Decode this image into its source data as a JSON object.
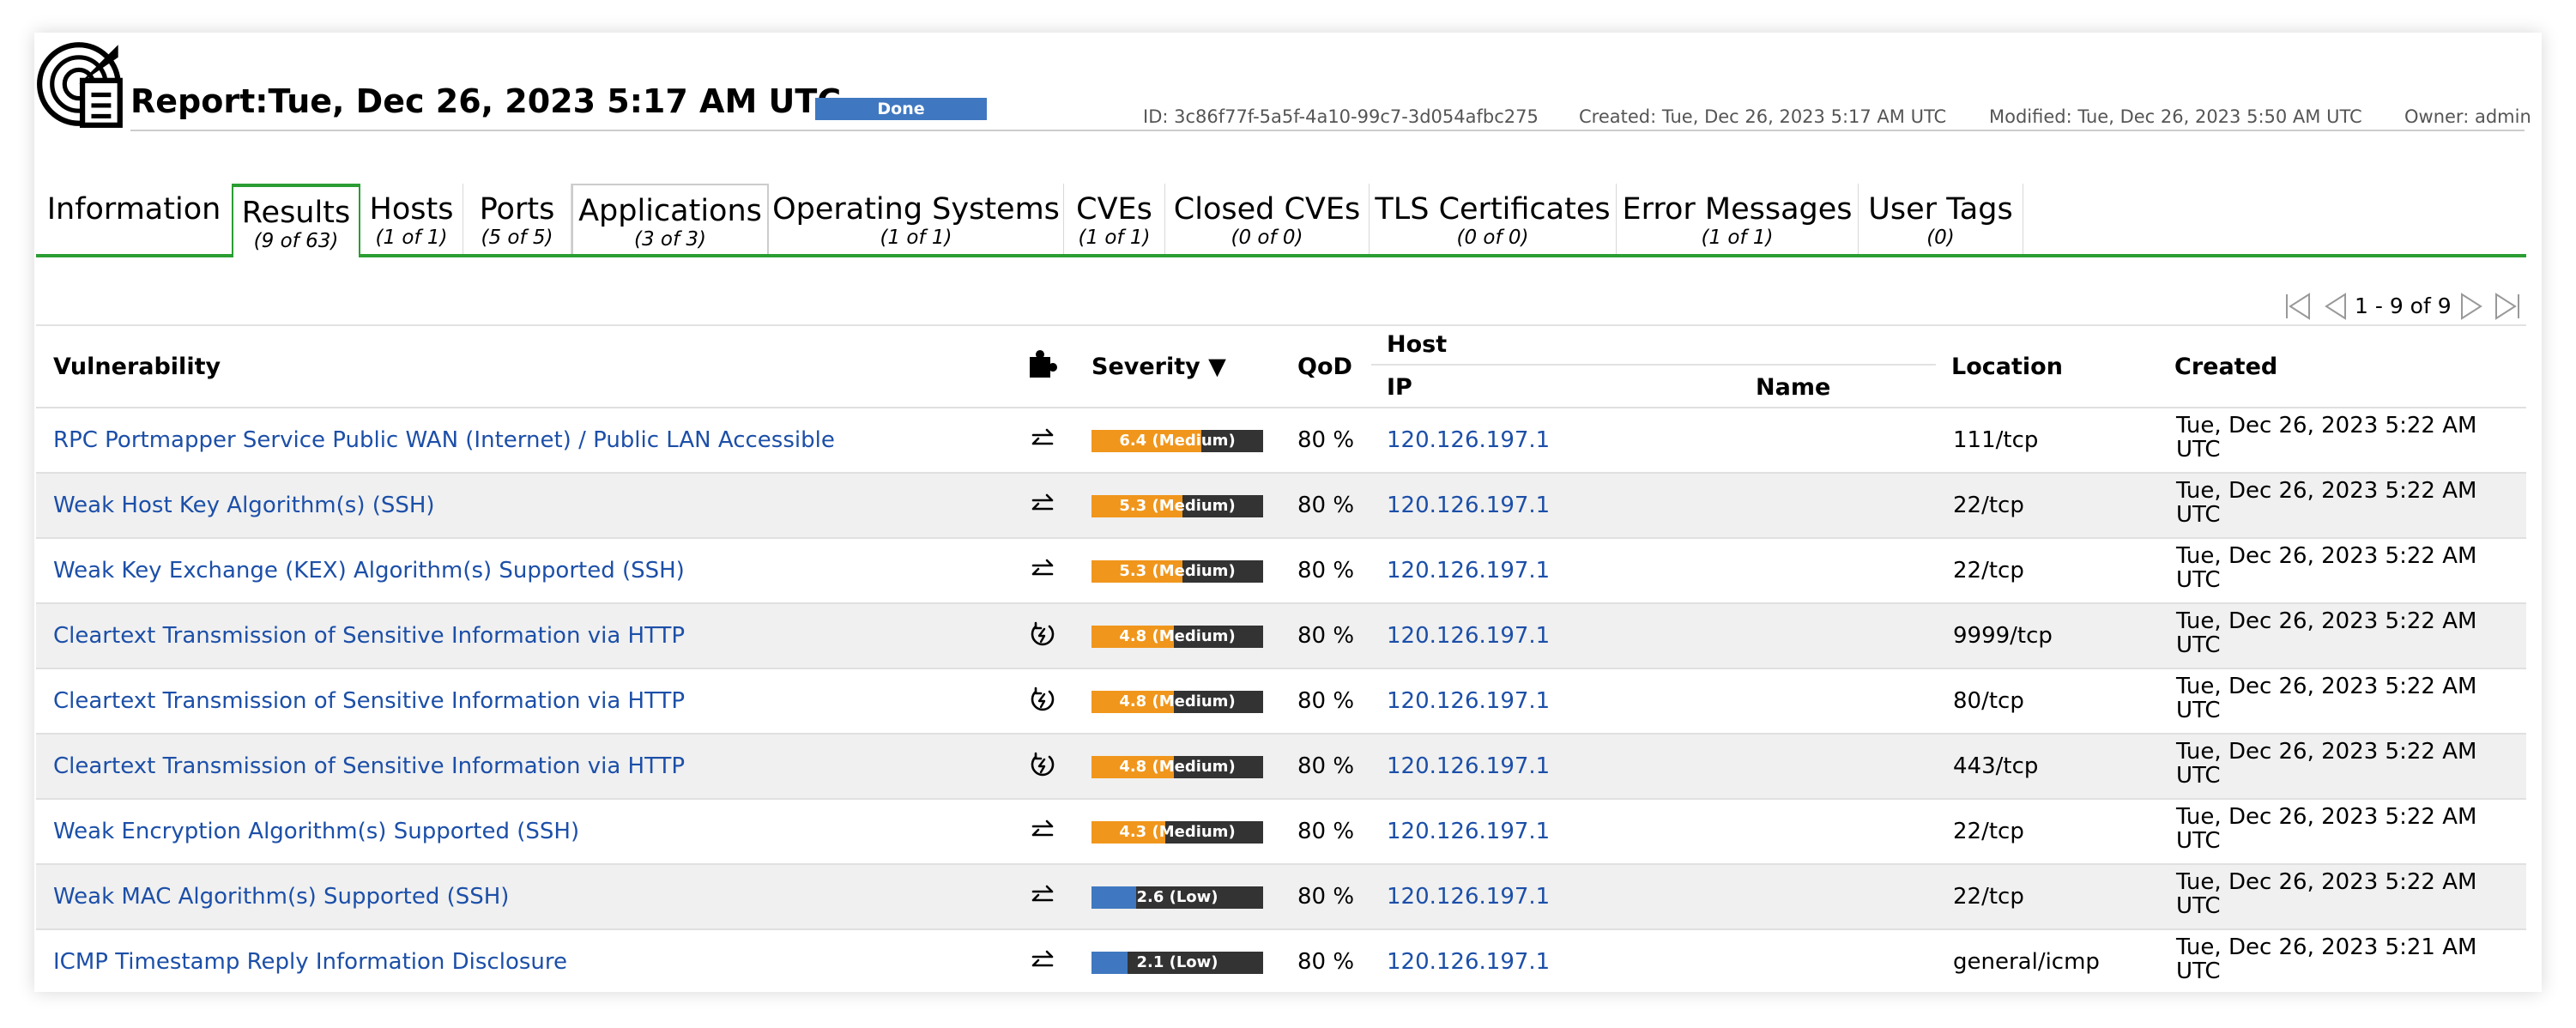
{
  "header": {
    "title": "Report:Tue, Dec 26, 2023 5:17 AM UTC",
    "status": "Done",
    "id": "ID: 3c86f77f-5a5f-4a10-99c7-3d054afbc275",
    "created": "Created: Tue, Dec 26, 2023 5:17 AM UTC",
    "modified": "Modified: Tue, Dec 26, 2023 5:50 AM UTC",
    "owner": "Owner: admin"
  },
  "tabs": [
    {
      "label": "Information",
      "count": ""
    },
    {
      "label": "Results",
      "count": "(9 of 63)"
    },
    {
      "label": "Hosts",
      "count": "(1 of 1)"
    },
    {
      "label": "Ports",
      "count": "(5 of 5)"
    },
    {
      "label": "Applications",
      "count": "(3 of 3)"
    },
    {
      "label": "Operating Systems",
      "count": "(1 of 1)"
    },
    {
      "label": "CVEs",
      "count": "(1 of 1)"
    },
    {
      "label": "Closed CVEs",
      "count": "(0 of 0)"
    },
    {
      "label": "TLS Certificates",
      "count": "(0 of 0)"
    },
    {
      "label": "Error Messages",
      "count": "(1 of 1)"
    },
    {
      "label": "User Tags",
      "count": "(0)"
    }
  ],
  "pagination": {
    "text": "1 - 9 of 9"
  },
  "table": {
    "headers": {
      "vulnerability": "Vulnerability",
      "severity": "Severity ▼",
      "qod": "QoD",
      "host": "Host",
      "ip": "IP",
      "name": "Name",
      "location": "Location",
      "created": "Created"
    },
    "rows": [
      {
        "vulnerability": "RPC Portmapper Service Public WAN (Internet) / Public LAN Accessible",
        "icon": "exchange-arrows-icon",
        "severity_score": 6.4,
        "severity_label": "6.4 (Medium)",
        "qod": "80 %",
        "ip": "120.126.197.1",
        "name": "",
        "location": "111/tcp",
        "created_line1": "Tue, Dec 26, 2023 5:22 AM",
        "created_line2": "UTC"
      },
      {
        "vulnerability": "Weak Host Key Algorithm(s) (SSH)",
        "icon": "exchange-arrows-icon",
        "severity_score": 5.3,
        "severity_label": "5.3 (Medium)",
        "qod": "80 %",
        "ip": "120.126.197.1",
        "name": "",
        "location": "22/tcp",
        "created_line1": "Tue, Dec 26, 2023 5:22 AM",
        "created_line2": "UTC"
      },
      {
        "vulnerability": "Weak Key Exchange (KEX) Algorithm(s) Supported (SSH)",
        "icon": "exchange-arrows-icon",
        "severity_score": 5.3,
        "severity_label": "5.3 (Medium)",
        "qod": "80 %",
        "ip": "120.126.197.1",
        "name": "",
        "location": "22/tcp",
        "created_line1": "Tue, Dec 26, 2023 5:22 AM",
        "created_line2": "UTC"
      },
      {
        "vulnerability": "Cleartext Transmission of Sensitive Information via HTTP",
        "icon": "mitigate-cycle-icon",
        "severity_score": 4.8,
        "severity_label": "4.8 (Medium)",
        "qod": "80 %",
        "ip": "120.126.197.1",
        "name": "",
        "location": "9999/tcp",
        "created_line1": "Tue, Dec 26, 2023 5:22 AM",
        "created_line2": "UTC"
      },
      {
        "vulnerability": "Cleartext Transmission of Sensitive Information via HTTP",
        "icon": "mitigate-cycle-icon",
        "severity_score": 4.8,
        "severity_label": "4.8 (Medium)",
        "qod": "80 %",
        "ip": "120.126.197.1",
        "name": "",
        "location": "80/tcp",
        "created_line1": "Tue, Dec 26, 2023 5:22 AM",
        "created_line2": "UTC"
      },
      {
        "vulnerability": "Cleartext Transmission of Sensitive Information via HTTP",
        "icon": "mitigate-cycle-icon",
        "severity_score": 4.8,
        "severity_label": "4.8 (Medium)",
        "qod": "80 %",
        "ip": "120.126.197.1",
        "name": "",
        "location": "443/tcp",
        "created_line1": "Tue, Dec 26, 2023 5:22 AM",
        "created_line2": "UTC"
      },
      {
        "vulnerability": "Weak Encryption Algorithm(s) Supported (SSH)",
        "icon": "exchange-arrows-icon",
        "severity_score": 4.3,
        "severity_label": "4.3 (Medium)",
        "qod": "80 %",
        "ip": "120.126.197.1",
        "name": "",
        "location": "22/tcp",
        "created_line1": "Tue, Dec 26, 2023 5:22 AM",
        "created_line2": "UTC"
      },
      {
        "vulnerability": "Weak MAC Algorithm(s) Supported (SSH)",
        "icon": "exchange-arrows-icon",
        "severity_score": 2.6,
        "severity_label": "2.6 (Low)",
        "qod": "80 %",
        "ip": "120.126.197.1",
        "name": "",
        "location": "22/tcp",
        "created_line1": "Tue, Dec 26, 2023 5:22 AM",
        "created_line2": "UTC"
      },
      {
        "vulnerability": "ICMP Timestamp Reply Information Disclosure",
        "icon": "exchange-arrows-icon",
        "severity_score": 2.1,
        "severity_label": "2.1 (Low)",
        "qod": "80 %",
        "ip": "120.126.197.1",
        "name": "",
        "location": "general/icmp",
        "created_line1": "Tue, Dec 26, 2023 5:21 AM",
        "created_line2": "UTC"
      }
    ]
  },
  "colors": {
    "medium": "#f0961c",
    "low": "#3f78c0",
    "track": "#333333",
    "link": "#1c4fa8",
    "tab_accent": "#2a9e33"
  }
}
